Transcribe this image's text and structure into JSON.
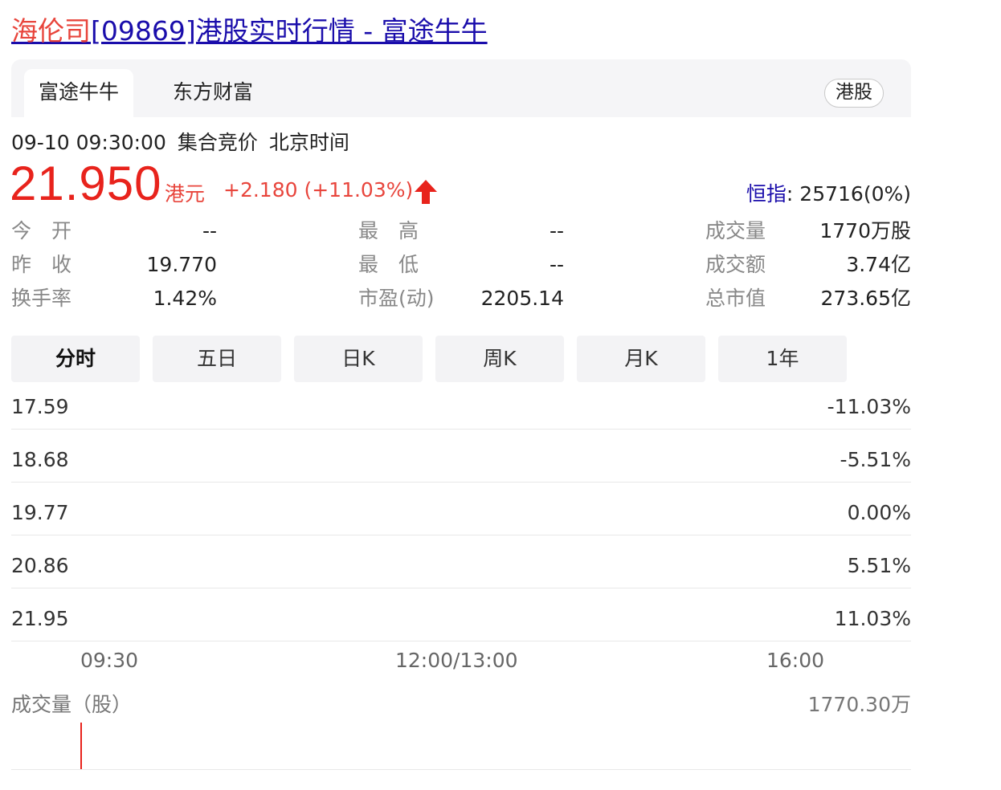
{
  "page_title": {
    "highlight": "海伦司",
    "rest": "[09869]港股实时行情 - 富途牛牛"
  },
  "tabs": [
    "富途牛牛",
    "东方财富"
  ],
  "market_badge": "港股",
  "quote_meta": {
    "datetime": "09-10 09:30:00",
    "session": "集合竞价",
    "timezone": "北京时间"
  },
  "price": "21.950",
  "currency": "港元",
  "change": "+2.180 (+11.03%)",
  "index_quote": {
    "name": "恒指",
    "value": ": 25716(0%)"
  },
  "stats": {
    "open": {
      "label": "今　开",
      "value": "--"
    },
    "prev_close": {
      "label": "昨　收",
      "value": "19.770"
    },
    "turnover_rate": {
      "label": "换手率",
      "value": "1.42%"
    },
    "high": {
      "label": "最　高",
      "value": "--"
    },
    "low": {
      "label": "最　低",
      "value": "--"
    },
    "pe": {
      "label": "市盈(动)",
      "value": "2205.14"
    },
    "volume": {
      "label": "成交量",
      "value": "1770万股"
    },
    "amount": {
      "label": "成交额",
      "value": "3.74亿"
    },
    "market_cap": {
      "label": "总市值",
      "value": "273.65亿"
    }
  },
  "kline_tabs": [
    "分时",
    "五日",
    "日K",
    "周K",
    "月K",
    "1年"
  ],
  "chart_data": {
    "type": "line",
    "price_axis": [
      "17.59",
      "18.68",
      "19.77",
      "20.86",
      "21.95"
    ],
    "pct_axis": [
      "-11.03%",
      "-5.51%",
      "0.00%",
      "5.51%",
      "11.03%"
    ],
    "x_ticks": [
      "09:30",
      "12:00/13:00",
      "16:00"
    ],
    "volume_label": "成交量（股）",
    "volume_max": "1770.30万"
  },
  "colors": {
    "up": "#e8231c",
    "link": "#1a0dab",
    "highlight": "#e8453c"
  }
}
